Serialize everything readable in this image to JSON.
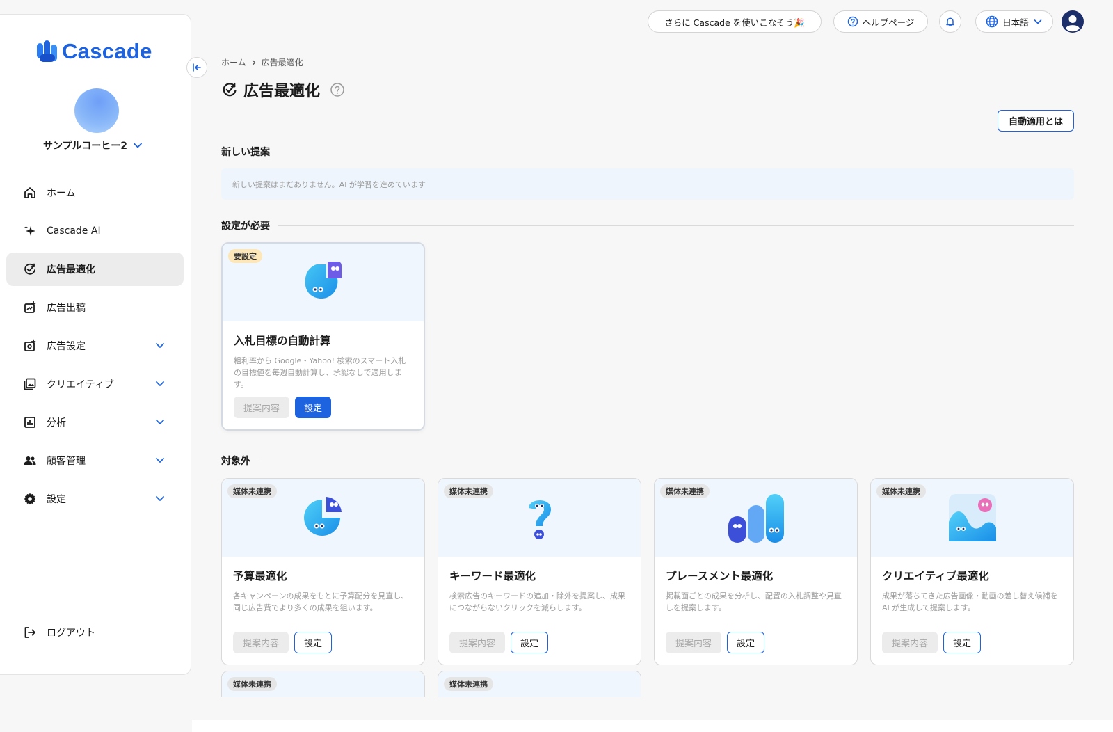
{
  "brand": {
    "name": "Cascade",
    "color": "#1d63e0"
  },
  "account": {
    "name": "サンプルコーヒー2"
  },
  "sidebar": {
    "items": [
      {
        "label": "ホーム",
        "icon": "home-icon",
        "active": false,
        "expandable": false
      },
      {
        "label": "Cascade AI",
        "icon": "sparkle-icon",
        "active": false,
        "expandable": false
      },
      {
        "label": "広告最適化",
        "icon": "optimize-icon",
        "active": true,
        "expandable": false
      },
      {
        "label": "広告出稿",
        "icon": "ad-publish-icon",
        "active": false,
        "expandable": false
      },
      {
        "label": "広告設定",
        "icon": "ad-settings-icon",
        "active": false,
        "expandable": true
      },
      {
        "label": "クリエイティブ",
        "icon": "image-gallery-icon",
        "active": false,
        "expandable": true
      },
      {
        "label": "分析",
        "icon": "analytics-icon",
        "active": false,
        "expandable": true
      },
      {
        "label": "顧客管理",
        "icon": "users-icon",
        "active": false,
        "expandable": true
      },
      {
        "label": "設定",
        "icon": "gear-icon",
        "active": false,
        "expandable": true
      }
    ],
    "logout_label": "ログアウト"
  },
  "header": {
    "promo_label": "さらに Cascade を使いこなそう🎉",
    "help_label": "ヘルプページ",
    "language_label": "日本語"
  },
  "breadcrumb": {
    "home": "ホーム",
    "current": "広告最適化"
  },
  "page": {
    "title": "広告最適化",
    "auto_apply_label": "自動適用とは"
  },
  "sections": {
    "new_proposals": {
      "title": "新しい提案",
      "empty_message": "新しい提案はまだありません。AI が学習を進めています"
    },
    "needs_setup": {
      "title": "設定が必要"
    },
    "not_applicable": {
      "title": "対象外"
    }
  },
  "setup_cards": [
    {
      "badge": "要設定",
      "title": "入札目標の自動計算",
      "description": "粗利率から Google・Yahoo! 検索のスマート入札の目標値を毎週自動計算し、承認なしで適用します。",
      "proposal_label": "提案内容",
      "setup_label": "設定"
    }
  ],
  "excluded_cards": [
    {
      "badge": "媒体未連携",
      "title": "予算最適化",
      "description": "各キャンペーンの成果をもとに予算配分を見直し、同じ広告費でより多くの成果を狙います。",
      "proposal_label": "提案内容",
      "setup_label": "設定"
    },
    {
      "badge": "媒体未連携",
      "title": "キーワード最適化",
      "description": "検索広告のキーワードの追加・除外を提案し、成果につながらないクリックを減らします。",
      "proposal_label": "提案内容",
      "setup_label": "設定"
    },
    {
      "badge": "媒体未連携",
      "title": "プレースメント最適化",
      "description": "掲載面ごとの成果を分析し、配置の入札調整や見直しを提案します。",
      "proposal_label": "提案内容",
      "setup_label": "設定"
    },
    {
      "badge": "媒体未連携",
      "title": "クリエイティブ最適化",
      "description": "成果が落ちてきた広告画像・動画の差し替え候補を AI が生成して提案します。",
      "proposal_label": "提案内容",
      "setup_label": "設定"
    }
  ],
  "partial_cards": [
    {
      "badge": "媒体未連携"
    },
    {
      "badge": "媒体未連携"
    }
  ]
}
